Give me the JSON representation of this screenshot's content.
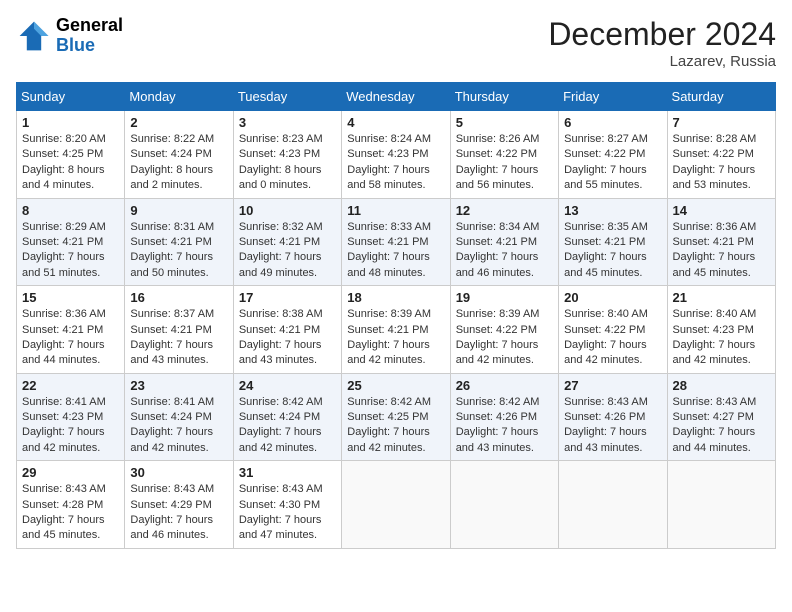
{
  "header": {
    "logo": {
      "general": "General",
      "blue": "Blue"
    },
    "title": "December 2024",
    "location": "Lazarev, Russia"
  },
  "weekdays": [
    "Sunday",
    "Monday",
    "Tuesday",
    "Wednesday",
    "Thursday",
    "Friday",
    "Saturday"
  ],
  "weeks": [
    [
      {
        "day": "1",
        "info": "Sunrise: 8:20 AM\nSunset: 4:25 PM\nDaylight: 8 hours\nand 4 minutes."
      },
      {
        "day": "2",
        "info": "Sunrise: 8:22 AM\nSunset: 4:24 PM\nDaylight: 8 hours\nand 2 minutes."
      },
      {
        "day": "3",
        "info": "Sunrise: 8:23 AM\nSunset: 4:23 PM\nDaylight: 8 hours\nand 0 minutes."
      },
      {
        "day": "4",
        "info": "Sunrise: 8:24 AM\nSunset: 4:23 PM\nDaylight: 7 hours\nand 58 minutes."
      },
      {
        "day": "5",
        "info": "Sunrise: 8:26 AM\nSunset: 4:22 PM\nDaylight: 7 hours\nand 56 minutes."
      },
      {
        "day": "6",
        "info": "Sunrise: 8:27 AM\nSunset: 4:22 PM\nDaylight: 7 hours\nand 55 minutes."
      },
      {
        "day": "7",
        "info": "Sunrise: 8:28 AM\nSunset: 4:22 PM\nDaylight: 7 hours\nand 53 minutes."
      }
    ],
    [
      {
        "day": "8",
        "info": "Sunrise: 8:29 AM\nSunset: 4:21 PM\nDaylight: 7 hours\nand 51 minutes."
      },
      {
        "day": "9",
        "info": "Sunrise: 8:31 AM\nSunset: 4:21 PM\nDaylight: 7 hours\nand 50 minutes."
      },
      {
        "day": "10",
        "info": "Sunrise: 8:32 AM\nSunset: 4:21 PM\nDaylight: 7 hours\nand 49 minutes."
      },
      {
        "day": "11",
        "info": "Sunrise: 8:33 AM\nSunset: 4:21 PM\nDaylight: 7 hours\nand 48 minutes."
      },
      {
        "day": "12",
        "info": "Sunrise: 8:34 AM\nSunset: 4:21 PM\nDaylight: 7 hours\nand 46 minutes."
      },
      {
        "day": "13",
        "info": "Sunrise: 8:35 AM\nSunset: 4:21 PM\nDaylight: 7 hours\nand 45 minutes."
      },
      {
        "day": "14",
        "info": "Sunrise: 8:36 AM\nSunset: 4:21 PM\nDaylight: 7 hours\nand 45 minutes."
      }
    ],
    [
      {
        "day": "15",
        "info": "Sunrise: 8:36 AM\nSunset: 4:21 PM\nDaylight: 7 hours\nand 44 minutes."
      },
      {
        "day": "16",
        "info": "Sunrise: 8:37 AM\nSunset: 4:21 PM\nDaylight: 7 hours\nand 43 minutes."
      },
      {
        "day": "17",
        "info": "Sunrise: 8:38 AM\nSunset: 4:21 PM\nDaylight: 7 hours\nand 43 minutes."
      },
      {
        "day": "18",
        "info": "Sunrise: 8:39 AM\nSunset: 4:21 PM\nDaylight: 7 hours\nand 42 minutes."
      },
      {
        "day": "19",
        "info": "Sunrise: 8:39 AM\nSunset: 4:22 PM\nDaylight: 7 hours\nand 42 minutes."
      },
      {
        "day": "20",
        "info": "Sunrise: 8:40 AM\nSunset: 4:22 PM\nDaylight: 7 hours\nand 42 minutes."
      },
      {
        "day": "21",
        "info": "Sunrise: 8:40 AM\nSunset: 4:23 PM\nDaylight: 7 hours\nand 42 minutes."
      }
    ],
    [
      {
        "day": "22",
        "info": "Sunrise: 8:41 AM\nSunset: 4:23 PM\nDaylight: 7 hours\nand 42 minutes."
      },
      {
        "day": "23",
        "info": "Sunrise: 8:41 AM\nSunset: 4:24 PM\nDaylight: 7 hours\nand 42 minutes."
      },
      {
        "day": "24",
        "info": "Sunrise: 8:42 AM\nSunset: 4:24 PM\nDaylight: 7 hours\nand 42 minutes."
      },
      {
        "day": "25",
        "info": "Sunrise: 8:42 AM\nSunset: 4:25 PM\nDaylight: 7 hours\nand 42 minutes."
      },
      {
        "day": "26",
        "info": "Sunrise: 8:42 AM\nSunset: 4:26 PM\nDaylight: 7 hours\nand 43 minutes."
      },
      {
        "day": "27",
        "info": "Sunrise: 8:43 AM\nSunset: 4:26 PM\nDaylight: 7 hours\nand 43 minutes."
      },
      {
        "day": "28",
        "info": "Sunrise: 8:43 AM\nSunset: 4:27 PM\nDaylight: 7 hours\nand 44 minutes."
      }
    ],
    [
      {
        "day": "29",
        "info": "Sunrise: 8:43 AM\nSunset: 4:28 PM\nDaylight: 7 hours\nand 45 minutes."
      },
      {
        "day": "30",
        "info": "Sunrise: 8:43 AM\nSunset: 4:29 PM\nDaylight: 7 hours\nand 46 minutes."
      },
      {
        "day": "31",
        "info": "Sunrise: 8:43 AM\nSunset: 4:30 PM\nDaylight: 7 hours\nand 47 minutes."
      },
      {
        "day": "",
        "info": ""
      },
      {
        "day": "",
        "info": ""
      },
      {
        "day": "",
        "info": ""
      },
      {
        "day": "",
        "info": ""
      }
    ]
  ]
}
